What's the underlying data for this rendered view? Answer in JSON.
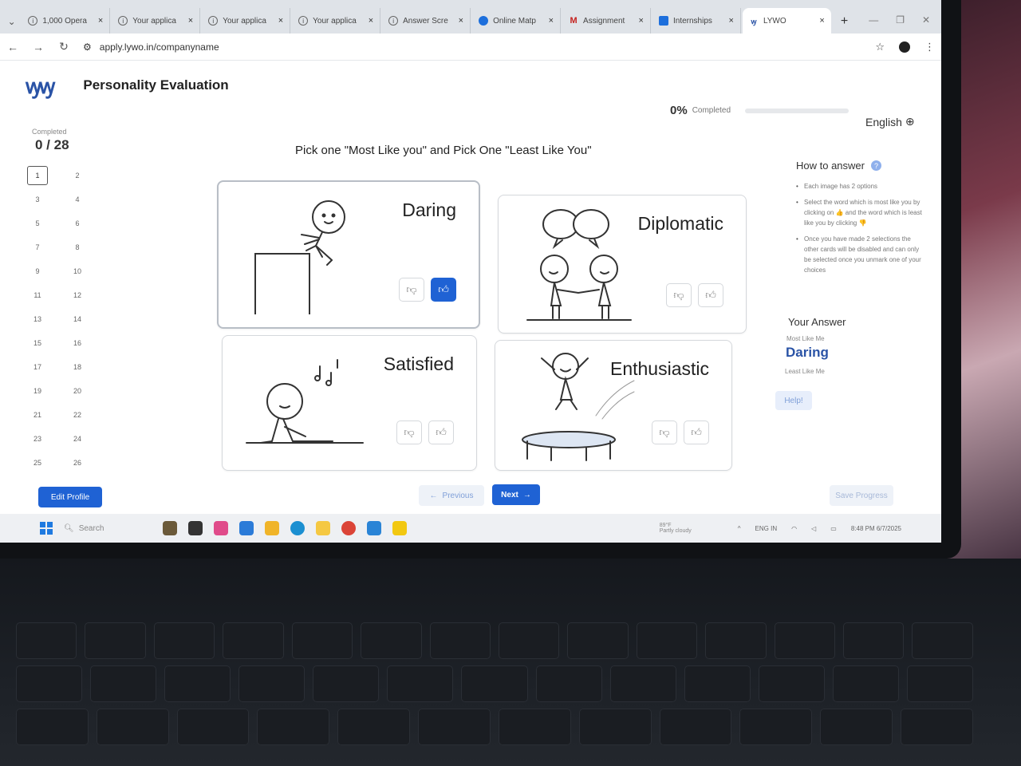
{
  "browser": {
    "tabs": [
      {
        "label": "1,000 Opera",
        "icon": "info-icon",
        "active": false
      },
      {
        "label": "Your applica",
        "icon": "info-icon",
        "active": false
      },
      {
        "label": "Your applica",
        "icon": "info-icon",
        "active": false
      },
      {
        "label": "Your applica",
        "icon": "info-icon",
        "active": false
      },
      {
        "label": "Answer Scre",
        "icon": "info-icon",
        "active": false
      },
      {
        "label": "Online Matp",
        "icon": "globe-icon",
        "active": false
      },
      {
        "label": "Assignment",
        "icon": "gmail-icon",
        "active": false
      },
      {
        "label": "Internships",
        "icon": "internshala-icon",
        "active": false
      },
      {
        "label": "LYWO",
        "icon": "lywo-icon",
        "active": true
      }
    ],
    "close_glyph": "×",
    "new_tab_glyph": "+",
    "url": "apply.lywo.in/companyname"
  },
  "app": {
    "logo_text": "ꝡꝡ",
    "title": "Personality Evaluation",
    "progress_percent": "0%",
    "progress_fraction": 0,
    "progress_label": "Completed",
    "language": "English",
    "accent_color": "#1f62d4",
    "brand_color": "#2a53a6"
  },
  "sidebar": {
    "completed_label": "Completed",
    "completed_count": "0 / 28",
    "questions": [
      "1",
      "2",
      "3",
      "4",
      "5",
      "6",
      "7",
      "8",
      "9",
      "10",
      "11",
      "12",
      "13",
      "14",
      "15",
      "16",
      "17",
      "18",
      "19",
      "20",
      "21",
      "22",
      "23",
      "24",
      "25",
      "26"
    ],
    "current_question": "1"
  },
  "question": {
    "prompt": "Pick one \"Most Like you\" and Pick One \"Least Like You\""
  },
  "cards": [
    {
      "word": "Daring",
      "most_selected": true
    },
    {
      "word": "Diplomatic",
      "most_selected": false
    },
    {
      "word": "Satisfied",
      "most_selected": false
    },
    {
      "word": "Enthusiastic",
      "most_selected": false
    }
  ],
  "how_to": {
    "title": "How to answer",
    "help_glyph": "?",
    "items": [
      "Each image has 2 options",
      "Select the word which is most like you by clicking on 👍 and the word which is least like you by clicking 👎",
      "Once you have made 2 selections the other cards will be disabled and can only be selected once you unmark one of your choices"
    ]
  },
  "your_answer": {
    "title": "Your Answer",
    "most_label": "Most Like Me",
    "most_value": "Daring",
    "least_label": "Least Like Me",
    "help_button": "Help!"
  },
  "buttons": {
    "edit_profile": "Edit Profile",
    "previous": "Previous",
    "next": "Next",
    "save_progress": "Save Progress"
  },
  "taskbar": {
    "search_placeholder": "Search",
    "weather_temp": "89°F",
    "weather_desc": "Partly cloudy",
    "lang": "ENG",
    "region": "IN",
    "time": "8:48 PM",
    "date": "6/7/2025"
  }
}
